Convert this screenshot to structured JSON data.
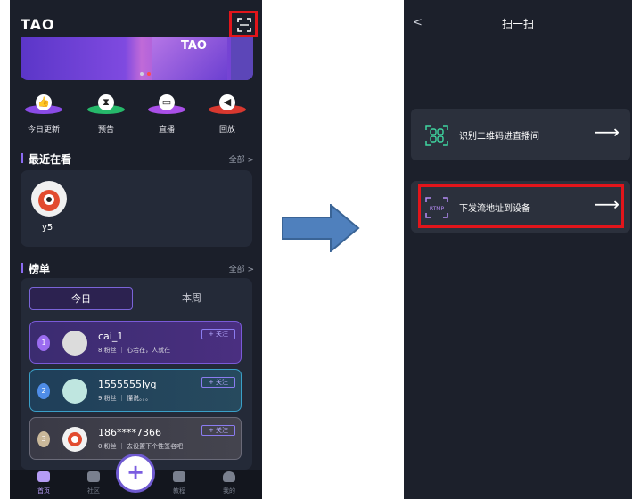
{
  "left_phone": {
    "logo": "TAO",
    "banner_text": "TAO",
    "categories": [
      {
        "label": "今日更新",
        "icon": "today-update-icon",
        "color": "#9b5cf0"
      },
      {
        "label": "预告",
        "icon": "preview-icon",
        "color": "#2fc77a"
      },
      {
        "label": "直播",
        "icon": "live-icon",
        "color": "#b85cf0"
      },
      {
        "label": "回放",
        "icon": "replay-icon",
        "color": "#e0413a"
      }
    ],
    "recent": {
      "title": "最近在看",
      "more": "全部 >",
      "user": "y5"
    },
    "ranking": {
      "title": "榜单",
      "more": "全部 >",
      "tabs": [
        "今日",
        "本周"
      ],
      "items": [
        {
          "name": "cai_1",
          "sub": "8 粉丝 ｜ 心若在，人就在",
          "follow": "+ 关注",
          "medal": "1",
          "medal_color": "#9b6cf0",
          "bg": "#3a2a6a"
        },
        {
          "name": "1555555lyq",
          "sub": "9 粉丝 ｜ 懂说。。。",
          "follow": "+ 关注",
          "medal": "2",
          "medal_color": "#4f8de8",
          "bg": "#1f4458"
        },
        {
          "name": "186****7366",
          "sub": "0 粉丝 ｜ 去设置下个性签名吧",
          "follow": "+ 关注",
          "medal": "3",
          "medal_color": "#c9b89a",
          "bg": "#3a3a44"
        }
      ]
    },
    "tabbar": [
      {
        "label": "首页",
        "icon": "home-icon",
        "active": true
      },
      {
        "label": "社区",
        "icon": "community-icon",
        "active": false
      },
      {
        "label": "教程",
        "icon": "tutorial-icon",
        "active": false
      },
      {
        "label": "我的",
        "icon": "profile-icon",
        "active": false
      }
    ],
    "plus": "+"
  },
  "right_phone": {
    "back": "<",
    "title": "扫一扫",
    "options": [
      {
        "label": "识别二维码进直播间",
        "icon": "qr-code-icon",
        "arrow": "⟶"
      },
      {
        "label": "下发流地址到设备",
        "icon": "rtmp-icon",
        "icon_text": "RTMP",
        "arrow": "⟶"
      }
    ]
  },
  "colors": {
    "highlight": "#e2151b",
    "arrow_fill": "#4f80bd",
    "accent": "#8b6bf2"
  }
}
